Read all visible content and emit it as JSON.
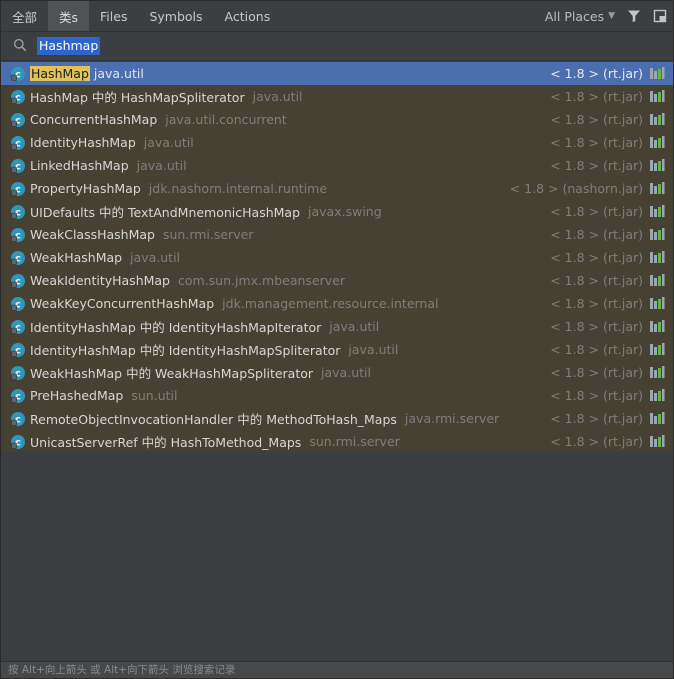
{
  "tabs": [
    {
      "label": "全部"
    },
    {
      "label": "类s"
    },
    {
      "label": "Files"
    },
    {
      "label": "Symbols"
    },
    {
      "label": "Actions"
    }
  ],
  "scope": {
    "label": "All Places"
  },
  "search": {
    "value": "Hashmap"
  },
  "results": [
    {
      "name_hl": "HashMap",
      "name_rest": "",
      "pkg": "java.util",
      "lib": "< 1.8 > (rt.jar)"
    },
    {
      "name_hl": "",
      "name_rest": "HashMap 中的 HashMapSpliterator",
      "pkg": "java.util",
      "lib": "< 1.8 > (rt.jar)"
    },
    {
      "name_hl": "",
      "name_rest": "ConcurrentHashMap",
      "pkg": "java.util.concurrent",
      "lib": "< 1.8 > (rt.jar)"
    },
    {
      "name_hl": "",
      "name_rest": "IdentityHashMap",
      "pkg": "java.util",
      "lib": "< 1.8 > (rt.jar)"
    },
    {
      "name_hl": "",
      "name_rest": "LinkedHashMap",
      "pkg": "java.util",
      "lib": "< 1.8 > (rt.jar)"
    },
    {
      "name_hl": "",
      "name_rest": "PropertyHashMap",
      "pkg": "jdk.nashorn.internal.runtime",
      "lib": "< 1.8 > (nashorn.jar)"
    },
    {
      "name_hl": "",
      "name_rest": "UIDefaults 中的 TextAndMnemonicHashMap",
      "pkg": "javax.swing",
      "lib": "< 1.8 > (rt.jar)"
    },
    {
      "name_hl": "",
      "name_rest": "WeakClassHashMap",
      "pkg": "sun.rmi.server",
      "lib": "< 1.8 > (rt.jar)"
    },
    {
      "name_hl": "",
      "name_rest": "WeakHashMap",
      "pkg": "java.util",
      "lib": "< 1.8 > (rt.jar)"
    },
    {
      "name_hl": "",
      "name_rest": "WeakIdentityHashMap",
      "pkg": "com.sun.jmx.mbeanserver",
      "lib": "< 1.8 > (rt.jar)"
    },
    {
      "name_hl": "",
      "name_rest": "WeakKeyConcurrentHashMap",
      "pkg": "jdk.management.resource.internal",
      "lib": "< 1.8 > (rt.jar)"
    },
    {
      "name_hl": "",
      "name_rest": "IdentityHashMap 中的 IdentityHashMapIterator",
      "pkg": "java.util",
      "lib": "< 1.8 > (rt.jar)"
    },
    {
      "name_hl": "",
      "name_rest": "IdentityHashMap 中的 IdentityHashMapSpliterator",
      "pkg": "java.util",
      "lib": "< 1.8 > (rt.jar)"
    },
    {
      "name_hl": "",
      "name_rest": "WeakHashMap 中的 WeakHashMapSpliterator",
      "pkg": "java.util",
      "lib": "< 1.8 > (rt.jar)"
    },
    {
      "name_hl": "",
      "name_rest": "PreHashedMap",
      "pkg": "sun.util",
      "lib": "< 1.8 > (rt.jar)"
    },
    {
      "name_hl": "",
      "name_rest": "RemoteObjectInvocationHandler 中的 MethodToHash_Maps",
      "pkg": "java.rmi.server",
      "lib": "< 1.8 > (rt.jar)"
    },
    {
      "name_hl": "",
      "name_rest": "UnicastServerRef 中的 HashToMethod_Maps",
      "pkg": "sun.rmi.server",
      "lib": "< 1.8 > (rt.jar)"
    }
  ],
  "status": {
    "text": "按 Alt+向上箭头 或 Alt+向下箭头 浏览搜索记录"
  },
  "icons": {
    "class": "class-icon",
    "library": "library-icon",
    "filter": "filter-icon",
    "preview": "preview-panel-icon",
    "search": "search-icon"
  },
  "colors": {
    "selection": "#4b6eaf",
    "row_bg": "#464133",
    "highlight": "#e2c35a",
    "class_icon": "#2f97b9"
  }
}
